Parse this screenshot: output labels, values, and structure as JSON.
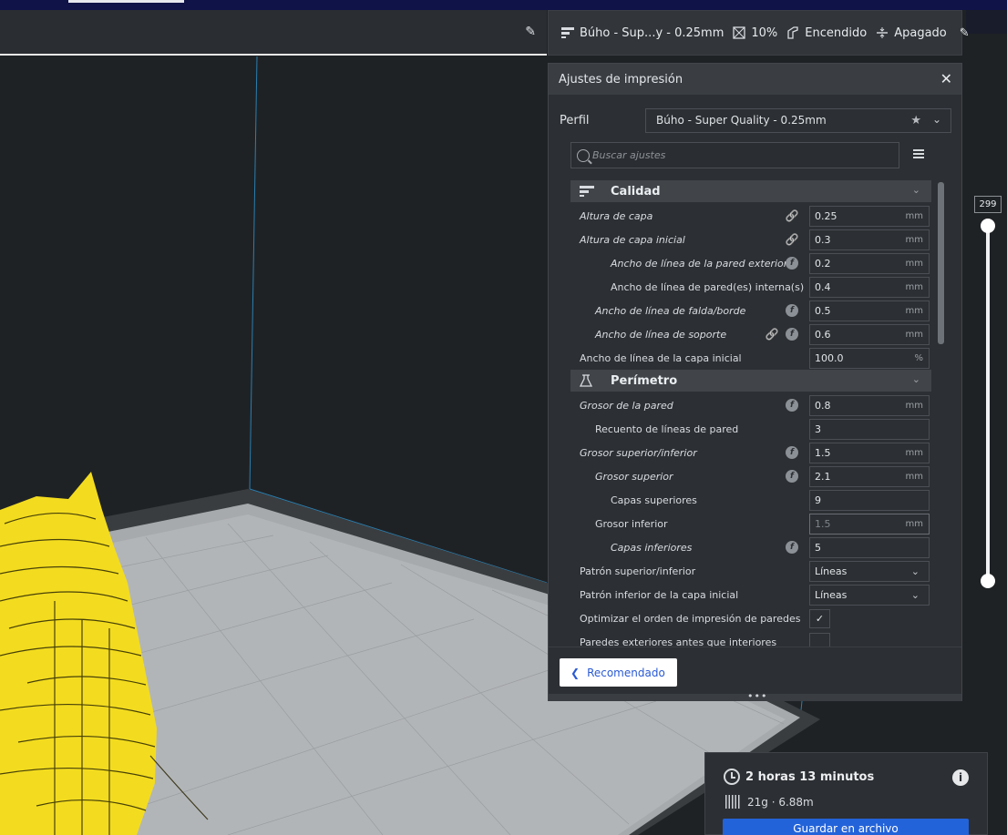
{
  "stage_bar": {
    "edit_icon": "pencil-icon"
  },
  "summary": {
    "profile": "Búho - Sup...y - 0.25mm",
    "infill": "10%",
    "support": "Encendido",
    "adhesion": "Apagado",
    "icons": [
      "quality-icon",
      "infill-icon",
      "support-icon",
      "adhesion-icon",
      "pencil-icon"
    ]
  },
  "panel": {
    "title": "Ajustes de impresión",
    "profile_label": "Perfil",
    "profile_value": "Búho - Super Quality - 0.25mm",
    "search_placeholder": "Buscar ajustes",
    "categories": [
      {
        "title": "Calidad",
        "icon": "quality-icon",
        "rows": [
          {
            "label": "Altura de capa",
            "italic": true,
            "indent": 0,
            "icons": [
              "link"
            ],
            "value": "0.25",
            "unit": "mm"
          },
          {
            "label": "Altura de capa inicial",
            "italic": true,
            "indent": 0,
            "icons": [
              "link"
            ],
            "value": "0.3",
            "unit": "mm"
          },
          {
            "label": "Ancho de línea de la pared exterior",
            "italic": true,
            "indent": 2,
            "icons": [
              "fx"
            ],
            "value": "0.2",
            "unit": "mm"
          },
          {
            "label": "Ancho de línea de pared(es) interna(s)",
            "italic": false,
            "indent": 2,
            "icons": [],
            "value": "0.4",
            "unit": "mm"
          },
          {
            "label": "Ancho de línea de falda/borde",
            "italic": true,
            "indent": 1,
            "icons": [
              "fx"
            ],
            "value": "0.5",
            "unit": "mm"
          },
          {
            "label": "Ancho de línea de soporte",
            "italic": true,
            "indent": 1,
            "icons": [
              "link",
              "fx"
            ],
            "value": "0.6",
            "unit": "mm"
          },
          {
            "label": "Ancho de línea de la capa inicial",
            "italic": false,
            "indent": 0,
            "icons": [],
            "value": "100.0",
            "unit": "%"
          }
        ]
      },
      {
        "title": "Perímetro",
        "icon": "shell-icon",
        "rows": [
          {
            "label": "Grosor de la pared",
            "italic": true,
            "indent": 0,
            "icons": [
              "fx"
            ],
            "value": "0.8",
            "unit": "mm"
          },
          {
            "label": "Recuento de líneas de pared",
            "italic": false,
            "indent": 1,
            "icons": [],
            "value": "3",
            "unit": ""
          },
          {
            "label": "Grosor superior/inferior",
            "italic": true,
            "indent": 0,
            "icons": [
              "fx"
            ],
            "value": "1.5",
            "unit": "mm"
          },
          {
            "label": "Grosor superior",
            "italic": true,
            "indent": 1,
            "icons": [
              "fx"
            ],
            "value": "2.1",
            "unit": "mm"
          },
          {
            "label": "Capas superiores",
            "italic": false,
            "indent": 2,
            "icons": [],
            "value": "9",
            "unit": ""
          },
          {
            "label": "Grosor inferior",
            "italic": false,
            "indent": 1,
            "icons": [],
            "value": "1.5",
            "unit": "mm",
            "dim": true
          },
          {
            "label": "Capas inferiores",
            "italic": true,
            "indent": 2,
            "icons": [
              "fx"
            ],
            "value": "5",
            "unit": ""
          },
          {
            "label": "Patrón superior/inferior",
            "italic": false,
            "indent": 0,
            "icons": [],
            "value": "Líneas",
            "unit": "",
            "type": "select"
          },
          {
            "label": "Patrón inferior de la capa inicial",
            "italic": false,
            "indent": 0,
            "icons": [],
            "value": "Líneas",
            "unit": "",
            "type": "select"
          },
          {
            "label": "Optimizar el orden de impresión de paredes",
            "italic": false,
            "indent": 0,
            "icons": [],
            "value": "✓",
            "unit": "",
            "type": "check"
          },
          {
            "label": "Paredes exteriores antes que interiores",
            "italic": false,
            "indent": 0,
            "icons": [],
            "value": "",
            "unit": "",
            "type": "check"
          }
        ]
      }
    ],
    "recommended_label": "Recomendado"
  },
  "layer_slider": {
    "top_value": "299"
  },
  "print_info": {
    "time": "2 horas 13 minutos",
    "material": "21g · 6.88m",
    "save_label": "Guardar en archivo"
  },
  "colors": {
    "accent": "#2363d9",
    "model": "#f3dc1f",
    "panel": "#2c2f33",
    "category": "#414549"
  }
}
